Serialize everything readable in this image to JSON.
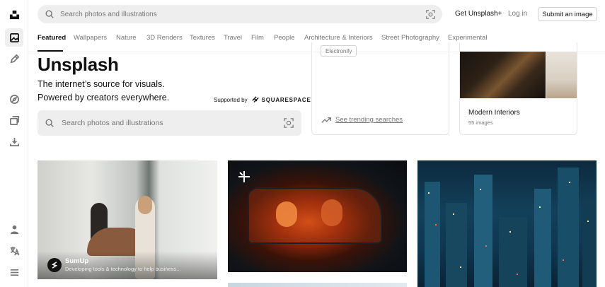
{
  "rail": {
    "items": [
      {
        "name": "unsplash-logo-icon"
      },
      {
        "name": "photos-icon",
        "active": true
      },
      {
        "name": "illustrations-pen-icon"
      },
      {
        "name": "explore-compass-icon"
      },
      {
        "name": "collections-icon"
      },
      {
        "name": "download-icon"
      },
      {
        "name": "account-icon"
      },
      {
        "name": "language-icon"
      },
      {
        "name": "menu-icon"
      }
    ]
  },
  "header": {
    "search_placeholder": "Search photos and illustrations",
    "get_plus": "Get Unsplash+",
    "login": "Log in",
    "submit": "Submit an image"
  },
  "tabs": [
    {
      "label": "Featured",
      "active": true
    },
    {
      "label": "Wallpapers"
    },
    {
      "label": "Nature"
    },
    {
      "label": "3D Renders"
    },
    {
      "label": "Textures"
    },
    {
      "label": "Travel"
    },
    {
      "label": "Film"
    },
    {
      "label": "People"
    },
    {
      "label": "Architecture & Interiors"
    },
    {
      "label": "Street Photography"
    },
    {
      "label": "Experimental"
    }
  ],
  "hero": {
    "title": "Unsplash",
    "line1": "The internet’s source for visuals.",
    "line2": "Powered by creators everywhere.",
    "supported_by": "Supported by",
    "sponsor_logo": "SQUARESPACE",
    "search_placeholder": "Search photos and illustrations"
  },
  "trending": {
    "chip": "Electronify",
    "link": "See trending searches"
  },
  "collection": {
    "title": "Modern Interiors",
    "count": "55 images"
  },
  "photos": {
    "sponsor_name": "SumUp",
    "sponsor_desc": "Developing tools & technology to help business..."
  },
  "colors": {
    "accent": "#111111",
    "muted": "#767676",
    "search_bg": "#eeeeee",
    "border": "#d1d1d1"
  }
}
